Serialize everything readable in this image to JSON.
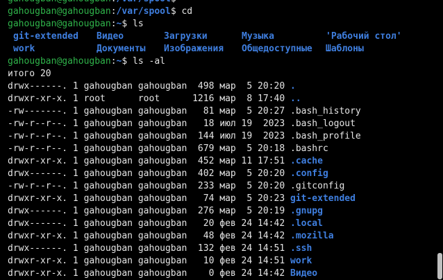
{
  "colors": {
    "background": "#000000",
    "prompt": "#2fb34a",
    "directory": "#3f7fe0",
    "text": "#e5e5e5"
  },
  "terminal": {
    "lines": [
      {
        "kind": "prompt",
        "prompt": "gahougban@gahougban",
        "sep": ":",
        "path": "/var/spool",
        "sym": "$",
        "cmd": ""
      },
      {
        "kind": "prompt",
        "prompt": "gahougban@gahougban",
        "sep": ":",
        "path": "/var/spool",
        "sym": "$",
        "cmd": " cd"
      },
      {
        "kind": "prompt",
        "prompt": "gahougban@gahougban",
        "sep": ":",
        "path": "~",
        "sym": "$",
        "cmd": " ls"
      },
      {
        "kind": "ls",
        "items": [
          "git-extended",
          "Видео",
          "Загрузки",
          "Музыка",
          "'Рабочий стол'"
        ]
      },
      {
        "kind": "ls",
        "items": [
          "work",
          "Документы",
          "Изображения",
          "Общедоступные",
          "Шаблоны"
        ]
      },
      {
        "kind": "prompt",
        "prompt": "gahougban@gahougban",
        "sep": ":",
        "path": "~",
        "sym": "$",
        "cmd": " ls -al"
      },
      {
        "kind": "text",
        "text": "итого 20"
      },
      {
        "kind": "entry",
        "meta": "drwx------. 1 gahougban gahougban  498 мар  5 20:20 ",
        "name": ".",
        "dir": true
      },
      {
        "kind": "entry",
        "meta": "drwxr-xr-x. 1 root      root      1216 мар  8 17:40 ",
        "name": "..",
        "dir": true
      },
      {
        "kind": "entry",
        "meta": "-rw-------. 1 gahougban gahougban   81 мар  5 20:27 ",
        "name": ".bash_history",
        "dir": false
      },
      {
        "kind": "entry",
        "meta": "-rw-r--r--. 1 gahougban gahougban   18 июл 19  2023 ",
        "name": ".bash_logout",
        "dir": false
      },
      {
        "kind": "entry",
        "meta": "-rw-r--r--. 1 gahougban gahougban  144 июл 19  2023 ",
        "name": ".bash_profile",
        "dir": false
      },
      {
        "kind": "entry",
        "meta": "-rw-r--r--. 1 gahougban gahougban  679 мар  5 20:18 ",
        "name": ".bashrc",
        "dir": false
      },
      {
        "kind": "entry",
        "meta": "drwxr-xr-x. 1 gahougban gahougban  452 мар 11 17:51 ",
        "name": ".cache",
        "dir": true
      },
      {
        "kind": "entry",
        "meta": "drwx------. 1 gahougban gahougban  402 мар  5 20:20 ",
        "name": ".config",
        "dir": true
      },
      {
        "kind": "entry",
        "meta": "-rw-r--r--. 1 gahougban gahougban  233 мар  5 20:20 ",
        "name": ".gitconfig",
        "dir": false
      },
      {
        "kind": "entry",
        "meta": "drwxr-xr-x. 1 gahougban gahougban   74 мар  5 20:23 ",
        "name": "git-extended",
        "dir": true
      },
      {
        "kind": "entry",
        "meta": "drwx------. 1 gahougban gahougban  276 мар  5 20:19 ",
        "name": ".gnupg",
        "dir": true
      },
      {
        "kind": "entry",
        "meta": "drwx------. 1 gahougban gahougban   20 фев 24 14:42 ",
        "name": ".local",
        "dir": true
      },
      {
        "kind": "entry",
        "meta": "drwxr-xr-x. 1 gahougban gahougban   48 фев 24 14:42 ",
        "name": ".mozilla",
        "dir": true
      },
      {
        "kind": "entry",
        "meta": "drwx------. 1 gahougban gahougban  132 фев 24 14:51 ",
        "name": ".ssh",
        "dir": true
      },
      {
        "kind": "entry",
        "meta": "drwxr-xr-x. 1 gahougban gahougban   10 фев 24 14:51 ",
        "name": "work",
        "dir": true
      },
      {
        "kind": "entry",
        "meta": "drwxr-xr-x. 1 gahougban gahougban    0 фев 24 14:42 ",
        "name": "Видео",
        "dir": true
      }
    ]
  }
}
